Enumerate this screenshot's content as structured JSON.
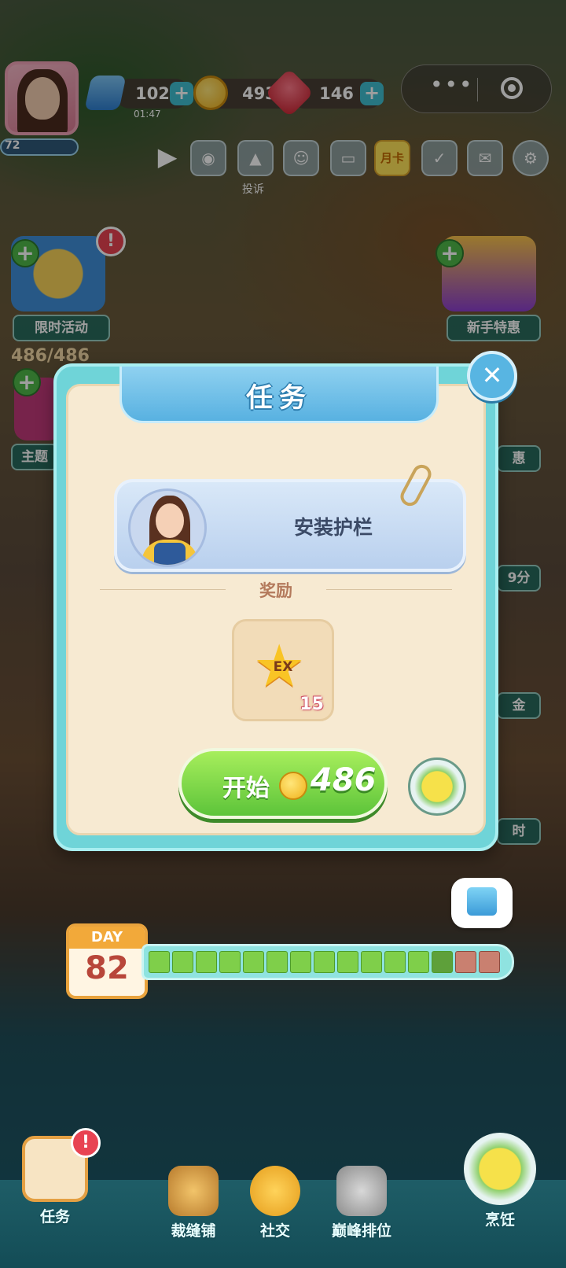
{
  "player": {
    "level": "72",
    "energy": "102",
    "energy_timer": "01:47",
    "coins": "493",
    "gems": "146"
  },
  "capsule": {
    "more_icon": "more-dots-icon",
    "close_icon": "record-circle-icon"
  },
  "toolbar": {
    "report_caption": "投诉",
    "month_card": "月卡"
  },
  "side_left": [
    {
      "label": "限时活动",
      "extra": "486/486"
    },
    {
      "label": "主题"
    }
  ],
  "side_right": [
    {
      "label": "新手特惠"
    },
    {
      "label": "惠"
    },
    {
      "label": "9分"
    },
    {
      "label": "金"
    },
    {
      "label": "时"
    }
  ],
  "dialog": {
    "title": "任务",
    "task_name": "安装护栏",
    "reward_heading": "奖励",
    "reward_badge": "EX",
    "reward_qty": "15",
    "start_label": "开始",
    "start_cost": "486"
  },
  "day": {
    "label": "DAY",
    "number": "82",
    "progress_filled": 12,
    "progress_current": 1,
    "progress_total": 15
  },
  "nav": [
    {
      "label": "任务"
    },
    {
      "label": "裁缝铺"
    },
    {
      "label": "社交"
    },
    {
      "label": "巅峰排位"
    },
    {
      "label": "烹饪"
    }
  ],
  "colors": {
    "dialog_frame": "#6fd4d8",
    "dialog_body": "#f7ead2",
    "start_button": "#5dc43a",
    "title_bar": "#58b1e1"
  }
}
